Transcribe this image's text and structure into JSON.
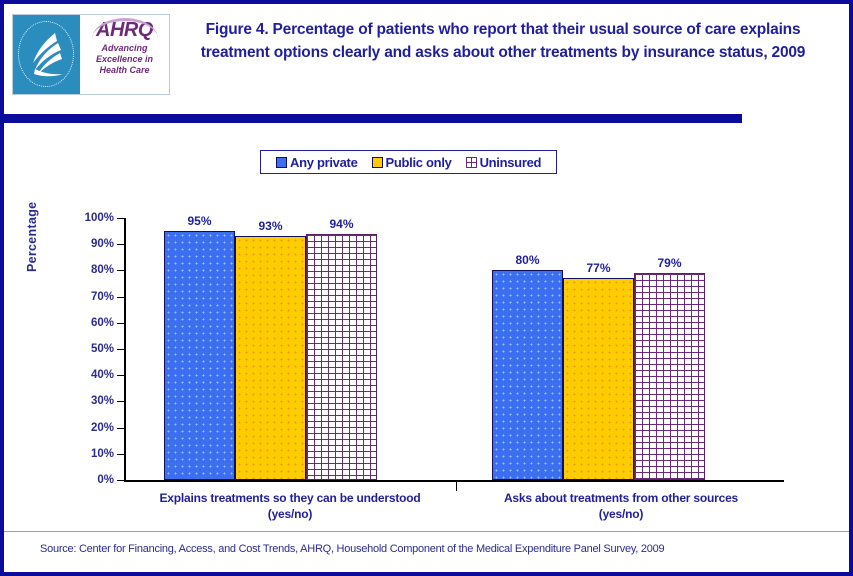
{
  "header": {
    "title": "Figure 4. Percentage of patients who report that their usual source of care explains treatment options clearly and asks about other treatments by insurance status, 2009",
    "logo": {
      "wordmark": "AHRQ",
      "tagline_line1": "Advancing",
      "tagline_line2": "Excellence in",
      "tagline_line3": "Health Care",
      "seal_name": "hhs-seal"
    }
  },
  "legend": {
    "items": [
      {
        "label": "Any private",
        "swatch": "blue-square",
        "color": "#3b6ff0"
      },
      {
        "label": "Public only",
        "swatch": "gold-square",
        "color": "#ffcc00"
      },
      {
        "label": "Uninsured",
        "swatch": "brick-pattern-square",
        "color": "#6d2a7a"
      }
    ]
  },
  "source_note": "Source: Center for Financing, Access, and Cost Trends, AHRQ,  Household Component of the Medical Expenditure Panel Survey,  2009",
  "colors": {
    "frame": "#0b0b9c",
    "title_text": "#1f1f9e",
    "axis_text": "#2b2b8f",
    "header_rule": "#0b0b9c"
  },
  "chart_data": {
    "type": "bar",
    "title": "Figure 4. Percentage of patients who report that their usual source of care explains treatment options clearly and asks about other treatments by insurance status, 2009",
    "xlabel": "",
    "ylabel": "Percentage",
    "ylim": [
      0,
      100
    ],
    "ytick_labels": [
      "100%",
      "90%",
      "80%",
      "70%",
      "60%",
      "50%",
      "40%",
      "30%",
      "20%",
      "10%",
      "0%"
    ],
    "ytick_values": [
      100,
      90,
      80,
      70,
      60,
      50,
      40,
      30,
      20,
      10,
      0
    ],
    "grid": false,
    "legend_position": "top-center",
    "categories": [
      "Explains treatments so they can be understood (yes/no)",
      "Asks about treatments from other sources (yes/no)"
    ],
    "category_lines": [
      [
        "Explains treatments so they can be understood",
        "(yes/no)"
      ],
      [
        "Asks about treatments from other sources",
        "(yes/no)"
      ]
    ],
    "series": [
      {
        "name": "Any private",
        "values": [
          95,
          80
        ],
        "labels": [
          "95%",
          "80%"
        ],
        "color": "#3b6ff0"
      },
      {
        "name": "Public only",
        "values": [
          93,
          77
        ],
        "labels": [
          "93%",
          "77%"
        ],
        "color": "#ffcc00"
      },
      {
        "name": "Uninsured",
        "values": [
          94,
          79
        ],
        "labels": [
          "94%",
          "79%"
        ],
        "color": "#6d2a7a"
      }
    ]
  }
}
